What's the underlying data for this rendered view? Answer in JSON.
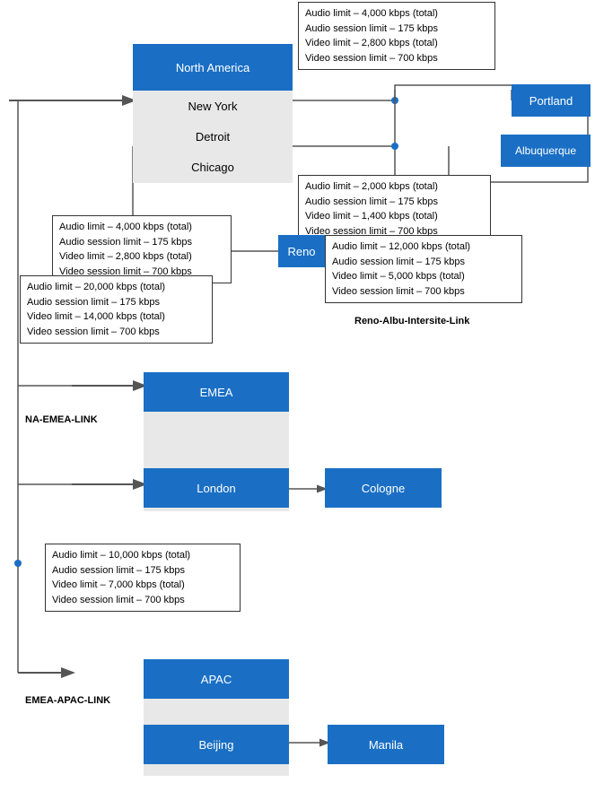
{
  "regions": {
    "north_america": {
      "label": "North America",
      "cities": [
        "New York",
        "Detroit",
        "Chicago"
      ]
    },
    "emea": {
      "label": "EMEA",
      "cities": [
        "London"
      ]
    },
    "apac": {
      "label": "APAC",
      "cities": [
        "Beijing"
      ]
    }
  },
  "nodes": {
    "portland": "Portland",
    "albuquerque": "Albuquerque",
    "reno": "Reno",
    "cologne": "Cologne",
    "manila": "Manila"
  },
  "info_boxes": {
    "top_right": {
      "lines": [
        "Audio limit – 4,000 kbps (total)",
        "Audio session limit – 175 kbps",
        "Video limit – 2,800 kbps (total)",
        "Video session limit – 700 kbps"
      ]
    },
    "albu_box": {
      "lines": [
        "Audio limit – 2,000 kbps (total)",
        "Audio session limit – 175 kbps",
        "Video limit – 1,400 kbps (total)",
        "Video session limit – 700 kbps"
      ]
    },
    "na_left": {
      "lines": [
        "Audio limit – 4,000 kbps (total)",
        "Audio session limit – 175 kbps",
        "Video limit – 2,800 kbps (total)",
        "Video session limit – 700 kbps"
      ]
    },
    "reno_left": {
      "lines": [
        "Audio limit – 20,000 kbps  (total)",
        "Audio session limit – 175 kbps",
        "Video limit – 14,000 kbps  (total)",
        "Video session limit – 700 kbps"
      ]
    },
    "reno_right": {
      "lines": [
        "Audio limit – 12,000 kbps  (total)",
        "Audio session limit – 175 kbps",
        "Video limit – 5,000 kbps (total)",
        "Video session limit – 700 kbps"
      ]
    },
    "emea_left": {
      "lines": [
        "Audio limit – 10,000 kbps  (total)",
        "Audio session limit – 175 kbps",
        "Video limit – 7,000 kbps  (total)",
        "Video session limit – 700 kbps"
      ]
    }
  },
  "link_labels": {
    "na_emea": "NA-EMEA-LINK",
    "emea_apac": "EMEA-APAC-LINK",
    "reno_albu": "Reno-Albu-Intersite-Link"
  }
}
